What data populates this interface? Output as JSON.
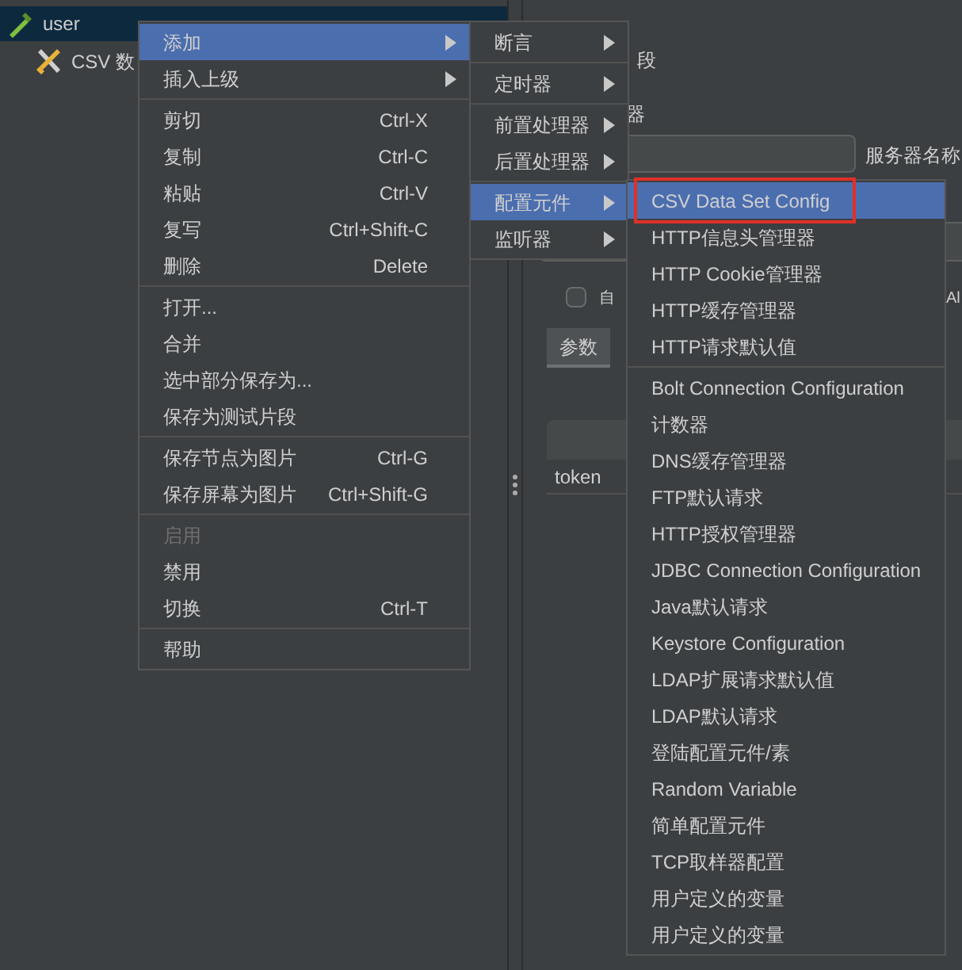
{
  "tree": [
    {
      "label": "user",
      "selected": true,
      "kind": "sampler"
    },
    {
      "label": "CSV 数",
      "selected": false,
      "kind": "config"
    }
  ],
  "panel": {
    "heading_fragment": "段",
    "section_fragment": "器",
    "server_label": "服务器名称",
    "checkbox": {
      "label": "自",
      "checked": false
    },
    "right_fragment": "Al",
    "tab": "参数",
    "cell": "token"
  },
  "context_menu": [
    {
      "kind": "item",
      "label": "添加",
      "submenu": true,
      "selected": true,
      "disabled": false
    },
    {
      "kind": "item",
      "label": "插入上级",
      "submenu": true,
      "selected": false,
      "disabled": false
    },
    {
      "kind": "separator"
    },
    {
      "kind": "item",
      "label": "剪切",
      "shortcut": "Ctrl-X",
      "selected": false,
      "disabled": false
    },
    {
      "kind": "item",
      "label": "复制",
      "shortcut": "Ctrl-C",
      "selected": false,
      "disabled": false
    },
    {
      "kind": "item",
      "label": "粘贴",
      "shortcut": "Ctrl-V",
      "selected": false,
      "disabled": false
    },
    {
      "kind": "item",
      "label": "复写",
      "shortcut": "Ctrl+Shift-C",
      "selected": false,
      "disabled": false
    },
    {
      "kind": "item",
      "label": "删除",
      "shortcut": "Delete",
      "selected": false,
      "disabled": false
    },
    {
      "kind": "separator"
    },
    {
      "kind": "item",
      "label": "打开...",
      "selected": false,
      "disabled": false
    },
    {
      "kind": "item",
      "label": "合并",
      "selected": false,
      "disabled": false
    },
    {
      "kind": "item",
      "label": "选中部分保存为...",
      "selected": false,
      "disabled": false
    },
    {
      "kind": "item",
      "label": "保存为测试片段",
      "selected": false,
      "disabled": false
    },
    {
      "kind": "separator"
    },
    {
      "kind": "item",
      "label": "保存节点为图片",
      "shortcut": "Ctrl-G",
      "selected": false,
      "disabled": false
    },
    {
      "kind": "item",
      "label": "保存屏幕为图片",
      "shortcut": "Ctrl+Shift-G",
      "selected": false,
      "disabled": false
    },
    {
      "kind": "separator"
    },
    {
      "kind": "item",
      "label": "启用",
      "selected": false,
      "disabled": true
    },
    {
      "kind": "item",
      "label": "禁用",
      "selected": false,
      "disabled": false
    },
    {
      "kind": "item",
      "label": "切换",
      "shortcut": "Ctrl-T",
      "selected": false,
      "disabled": false
    },
    {
      "kind": "separator"
    },
    {
      "kind": "item",
      "label": "帮助",
      "selected": false,
      "disabled": false
    }
  ],
  "add_submenu": [
    {
      "kind": "item",
      "label": "断言",
      "submenu": true,
      "selected": false
    },
    {
      "kind": "separator"
    },
    {
      "kind": "item",
      "label": "定时器",
      "submenu": true,
      "selected": false
    },
    {
      "kind": "separator"
    },
    {
      "kind": "item",
      "label": "前置处理器",
      "submenu": true,
      "selected": false
    },
    {
      "kind": "item",
      "label": "后置处理器",
      "submenu": true,
      "selected": false
    },
    {
      "kind": "separator"
    },
    {
      "kind": "item",
      "label": "配置元件",
      "submenu": true,
      "selected": true
    },
    {
      "kind": "item",
      "label": "监听器",
      "submenu": true,
      "selected": false
    }
  ],
  "config_submenu": [
    {
      "kind": "item",
      "label": "CSV Data Set Config",
      "selected": true,
      "outlined": true
    },
    {
      "kind": "item",
      "label": "HTTP信息头管理器",
      "selected": false,
      "outlined": false
    },
    {
      "kind": "item",
      "label": "HTTP Cookie管理器",
      "selected": false,
      "outlined": false
    },
    {
      "kind": "item",
      "label": "HTTP缓存管理器",
      "selected": false,
      "outlined": false
    },
    {
      "kind": "item",
      "label": "HTTP请求默认值",
      "selected": false,
      "outlined": false
    },
    {
      "kind": "separator"
    },
    {
      "kind": "item",
      "label": "Bolt Connection Configuration",
      "selected": false,
      "outlined": false
    },
    {
      "kind": "item",
      "label": "计数器",
      "selected": false,
      "outlined": false
    },
    {
      "kind": "item",
      "label": "DNS缓存管理器",
      "selected": false,
      "outlined": false
    },
    {
      "kind": "item",
      "label": "FTP默认请求",
      "selected": false,
      "outlined": false
    },
    {
      "kind": "item",
      "label": "HTTP授权管理器",
      "selected": false,
      "outlined": false
    },
    {
      "kind": "item",
      "label": "JDBC Connection Configuration",
      "selected": false,
      "outlined": false
    },
    {
      "kind": "item",
      "label": "Java默认请求",
      "selected": false,
      "outlined": false
    },
    {
      "kind": "item",
      "label": "Keystore Configuration",
      "selected": false,
      "outlined": false
    },
    {
      "kind": "item",
      "label": "LDAP扩展请求默认值",
      "selected": false,
      "outlined": false
    },
    {
      "kind": "item",
      "label": "LDAP默认请求",
      "selected": false,
      "outlined": false
    },
    {
      "kind": "item",
      "label": "登陆配置元件/素",
      "selected": false,
      "outlined": false
    },
    {
      "kind": "item",
      "label": "Random Variable",
      "selected": false,
      "outlined": false
    },
    {
      "kind": "item",
      "label": "简单配置元件",
      "selected": false,
      "outlined": false
    },
    {
      "kind": "item",
      "label": "TCP取样器配置",
      "selected": false,
      "outlined": false
    },
    {
      "kind": "item",
      "label": "用户定义的变量",
      "selected": false,
      "outlined": false
    },
    {
      "kind": "item",
      "label": "用户定义的变量",
      "selected": false,
      "outlined": false
    }
  ]
}
